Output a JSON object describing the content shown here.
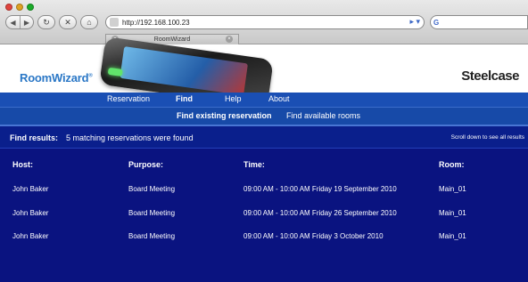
{
  "browser": {
    "url": "http://192.168.100.23",
    "tab_title": "RoomWizard",
    "search_glyph": "G"
  },
  "header": {
    "brand": "RoomWizard",
    "brand_mark": "®",
    "company": "Steelcase"
  },
  "nav": {
    "items": [
      "Reservation",
      "Find",
      "Help",
      "About"
    ],
    "active": "Find"
  },
  "subnav": {
    "items": [
      "Find existing reservation",
      "Find available rooms"
    ],
    "active": "Find existing reservation"
  },
  "results": {
    "label": "Find results:",
    "text": "5 matching reservations were found",
    "scroll_hint": "Scroll down to see all results"
  },
  "table": {
    "headers": [
      "Host:",
      "Purpose:",
      "Time:",
      "Room:"
    ],
    "rows": [
      [
        "John Baker",
        "Board Meeting",
        "09:00 AM - 10:00 AM Friday 19 September 2010",
        "Main_01"
      ],
      [
        "John Baker",
        "Board Meeting",
        "09:00 AM - 10:00 AM Friday 26 September 2010",
        "Main_01"
      ],
      [
        "John Baker",
        "Board Meeting",
        "09:00 AM - 10:00 AM Friday 3 October 2010",
        "Main_01"
      ]
    ]
  },
  "colors": {
    "brand_blue": "#2a77c6",
    "nav_blue": "#1a4fb4",
    "results_bg": "#0a1380"
  }
}
